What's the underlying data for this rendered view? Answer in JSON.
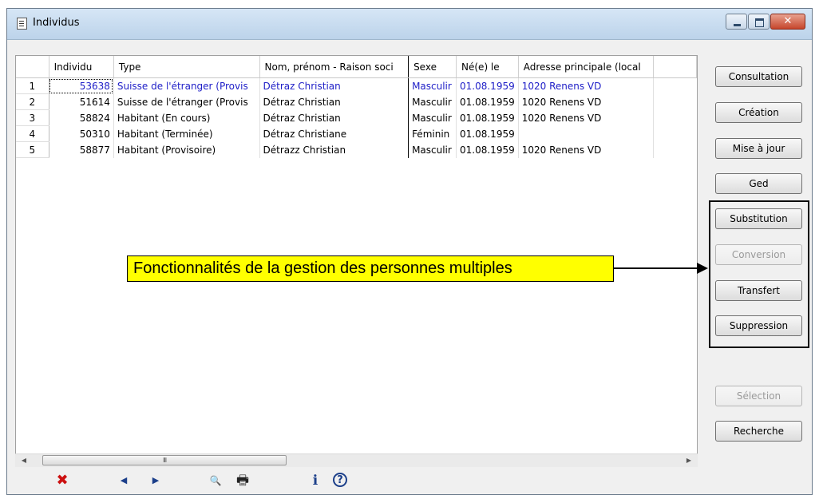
{
  "window": {
    "title": "Individus",
    "close_glyph": "✕"
  },
  "table": {
    "headers": [
      "Individu",
      "Type",
      "Nom, prénom - Raison soci",
      "Sexe",
      "Né(e) le",
      "Adresse principale (local"
    ],
    "rows": [
      {
        "n": "1",
        "id": "53638",
        "type": "Suisse de l'étranger (Provis",
        "name": "Détraz Christian",
        "sexe": "Masculir",
        "birth": "01.08.1959",
        "address": "1020 Renens VD"
      },
      {
        "n": "2",
        "id": "51614",
        "type": "Suisse de l'étranger (Provis",
        "name": "Détraz Christian",
        "sexe": "Masculir",
        "birth": "01.08.1959",
        "address": "1020 Renens VD"
      },
      {
        "n": "3",
        "id": "58824",
        "type": "Habitant (En cours)",
        "name": "Détraz Christian",
        "sexe": "Masculir",
        "birth": "01.08.1959",
        "address": "1020 Renens VD"
      },
      {
        "n": "4",
        "id": "50310",
        "type": "Habitant (Terminée)",
        "name": "Détraz Christiane",
        "sexe": "Féminin",
        "birth": "01.08.1959",
        "address": ""
      },
      {
        "n": "5",
        "id": "58877",
        "type": "Habitant (Provisoire)",
        "name": "Détrazz Christian",
        "sexe": "Masculir",
        "birth": "01.08.1959",
        "address": "1020 Renens VD"
      }
    ]
  },
  "scrollbar": {
    "left_arrow": "◀",
    "right_arrow": "▶",
    "grip": "III"
  },
  "buttons": {
    "consultation": "Consultation",
    "creation": "Création",
    "mise_a_jour": "Mise à jour",
    "ged": "Ged",
    "substitution": "Substitution",
    "conversion": "Conversion",
    "transfert": "Transfert",
    "suppression": "Suppression",
    "selection": "Sélection",
    "recherche": "Recherche"
  },
  "annotation": {
    "text": "Fonctionnalités de la gestion des personnes multiples"
  },
  "toolbar": {
    "delete_glyph": "✖",
    "prev_glyph": "◀",
    "next_glyph": "▶",
    "search_glyph": "🔍",
    "print_glyph": "🖶",
    "info_glyph": "ℹ",
    "help_glyph": "?"
  },
  "colors": {
    "selected_row_text": "#2020c8",
    "callout_bg": "#ffff00",
    "delete_icon": "#cc1010",
    "nav_icon": "#1c3f8a"
  }
}
